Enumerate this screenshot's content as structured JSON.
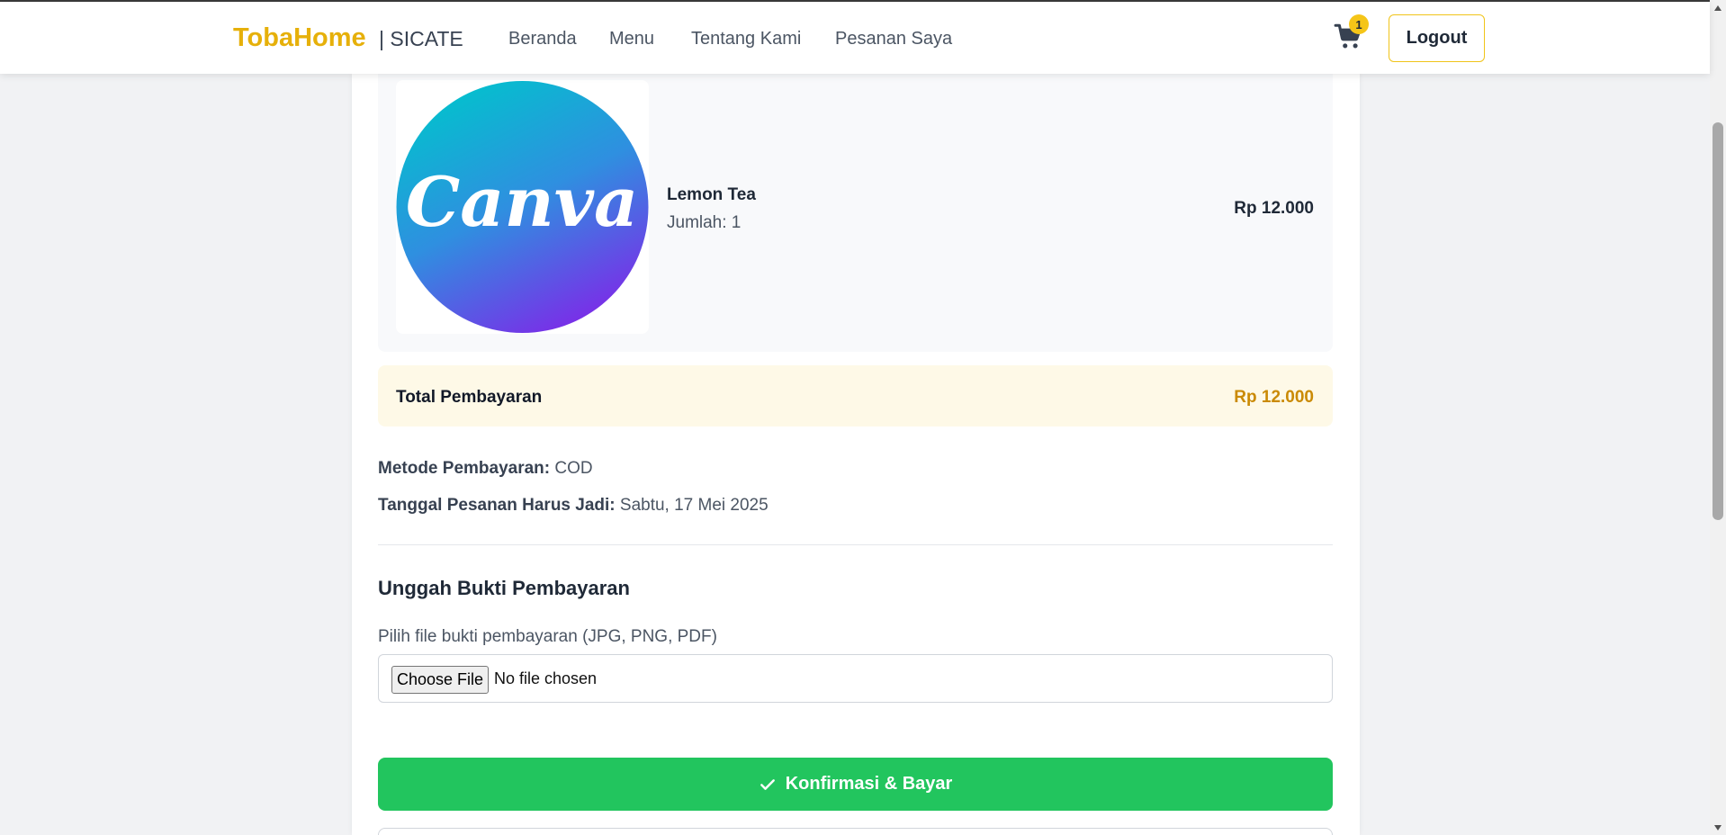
{
  "navbar": {
    "brand": "TobaHome",
    "brand_suffix": "| SICATE",
    "links": [
      "Beranda",
      "Menu",
      "Tentang Kami",
      "Pesanan Saya"
    ],
    "cart_count": "1",
    "logout_label": "Logout"
  },
  "order": {
    "item": {
      "image_label": "Canva",
      "name": "Lemon Tea",
      "quantity": "Jumlah: 1",
      "price": "Rp 12.000"
    },
    "total_label": "Total Pembayaran",
    "total_value": "Rp 12.000",
    "payment_method_label": "Metode Pembayaran:",
    "payment_method_value": " COD",
    "due_date_label": "Tanggal Pesanan Harus Jadi:",
    "due_date_value": " Sabtu, 17 Mei 2025"
  },
  "upload": {
    "title": "Unggah Bukti Pembayaran",
    "label": "Pilih file bukti pembayaran (JPG, PNG, PDF)",
    "choose_button": "Choose File",
    "no_file": "No file chosen"
  },
  "confirm_label": "Konfirmasi & Bayar",
  "colors": {
    "brand": "#e6b00a",
    "accent_green": "#22c55e",
    "total_value": "#ca8a04",
    "total_bg": "#fef9e7"
  }
}
